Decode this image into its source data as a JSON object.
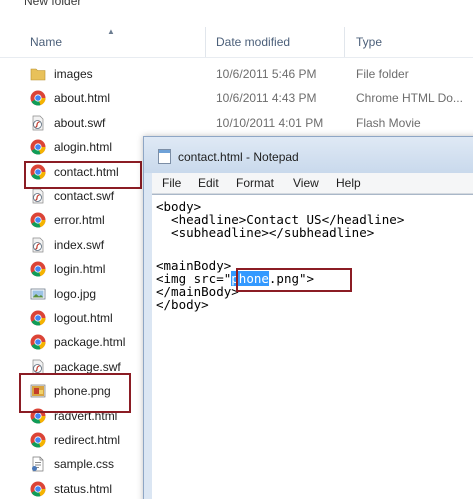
{
  "explorer": {
    "folder_title": "New folder",
    "columns": {
      "name": "Name",
      "date": "Date modified",
      "type": "Type"
    },
    "files": [
      {
        "name": "images",
        "date": "10/6/2011 5:46 PM",
        "type": "File folder",
        "icon": "folder-icon"
      },
      {
        "name": "about.html",
        "date": "10/6/2011 4:43 PM",
        "type": "Chrome HTML Do...",
        "icon": "chrome-icon"
      },
      {
        "name": "about.swf",
        "date": "10/10/2011 4:01 PM",
        "type": "Flash Movie",
        "icon": "flash-icon"
      },
      {
        "name": "alogin.html",
        "date": "",
        "type": "",
        "icon": "chrome-icon"
      },
      {
        "name": "contact.html",
        "date": "",
        "type": "",
        "icon": "chrome-icon"
      },
      {
        "name": "contact.swf",
        "date": "",
        "type": "",
        "icon": "flash-icon"
      },
      {
        "name": "error.html",
        "date": "",
        "type": "",
        "icon": "chrome-icon"
      },
      {
        "name": "index.swf",
        "date": "",
        "type": "",
        "icon": "flash-icon"
      },
      {
        "name": "login.html",
        "date": "",
        "type": "",
        "icon": "chrome-icon"
      },
      {
        "name": "logo.jpg",
        "date": "",
        "type": "",
        "icon": "image-icon"
      },
      {
        "name": "logout.html",
        "date": "",
        "type": "",
        "icon": "chrome-icon"
      },
      {
        "name": "package.html",
        "date": "",
        "type": "",
        "icon": "chrome-icon"
      },
      {
        "name": "package.swf",
        "date": "",
        "type": "",
        "icon": "flash-icon"
      },
      {
        "name": "phone.png",
        "date": "",
        "type": "",
        "icon": "png-icon"
      },
      {
        "name": "radvert.html",
        "date": "",
        "type": "",
        "icon": "chrome-icon"
      },
      {
        "name": "redirect.html",
        "date": "",
        "type": "",
        "icon": "chrome-icon"
      },
      {
        "name": "sample.css",
        "date": "",
        "type": "",
        "icon": "css-icon"
      },
      {
        "name": "status.html",
        "date": "",
        "type": "",
        "icon": "chrome-icon"
      }
    ]
  },
  "notepad": {
    "title": "contact.html - Notepad",
    "menu": [
      "File",
      "Edit",
      "Format",
      "View",
      "Help"
    ],
    "code": {
      "l1": "<body>",
      "l2": "  <headline>Contact US</headline>",
      "l3": "  <subheadline></subheadline>",
      "l4": "<mainBody>",
      "l5_pre": "<img src=\"",
      "l5_sel": "phone",
      "l5_post": ".png\">",
      "l6": "</mainBody>",
      "l7": "</body>"
    }
  },
  "colors": {
    "highlight": "#8b1c24",
    "selection": "#3399ff",
    "chrome_red": "#db4437",
    "chrome_green": "#0f9d58",
    "chrome_yellow": "#f4b400",
    "chrome_blue": "#4285f4",
    "folder": "#e8c15a"
  }
}
